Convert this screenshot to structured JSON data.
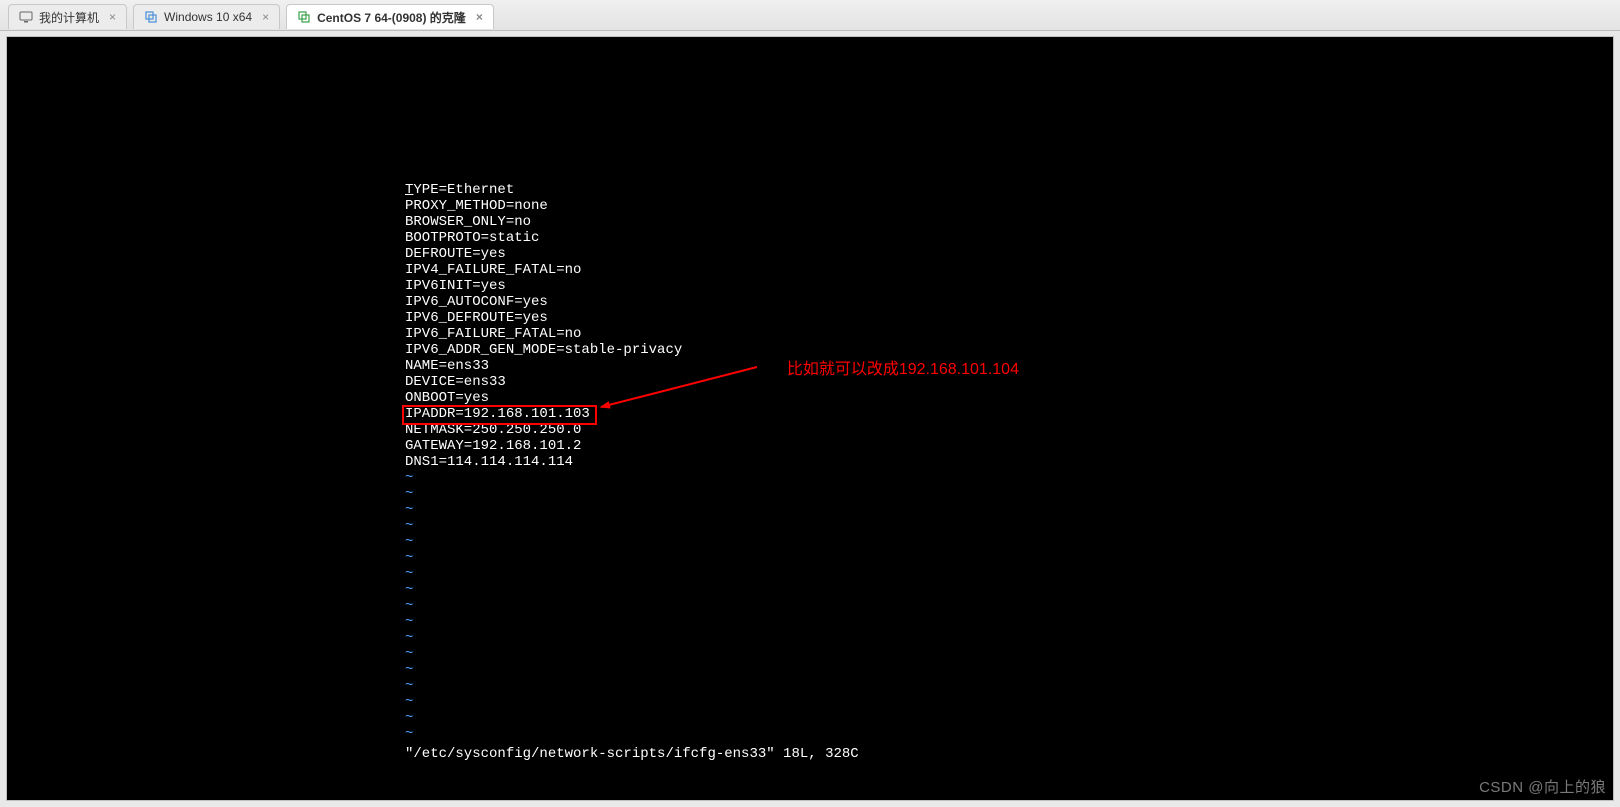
{
  "tabs": [
    {
      "label": "我的计算机",
      "icon": "monitor",
      "active": false
    },
    {
      "label": "Windows 10 x64",
      "icon": "vm",
      "active": false
    },
    {
      "label": "CentOS 7 64-(0908) 的克隆",
      "icon": "vm",
      "active": true
    }
  ],
  "config_lines": [
    "TYPE=Ethernet",
    "PROXY_METHOD=none",
    "BROWSER_ONLY=no",
    "BOOTPROTO=static",
    "DEFROUTE=yes",
    "IPV4_FAILURE_FATAL=no",
    "IPV6INIT=yes",
    "IPV6_AUTOCONF=yes",
    "IPV6_DEFROUTE=yes",
    "IPV6_FAILURE_FATAL=no",
    "IPV6_ADDR_GEN_MODE=stable-privacy",
    "NAME=ens33",
    "DEVICE=ens33",
    "ONBOOT=yes",
    "IPADDR=192.168.101.103",
    "NETMASK=250.250.250.0",
    "GATEWAY=192.168.101.2",
    "DNS1=114.114.114.114"
  ],
  "highlight_line_index": 14,
  "tilde_count": 17,
  "status_line": "\"/etc/sysconfig/network-scripts/ifcfg-ens33\" 18L, 328C",
  "annotation": "比如就可以改成192.168.101.104",
  "watermark": "CSDN @向上的狼"
}
